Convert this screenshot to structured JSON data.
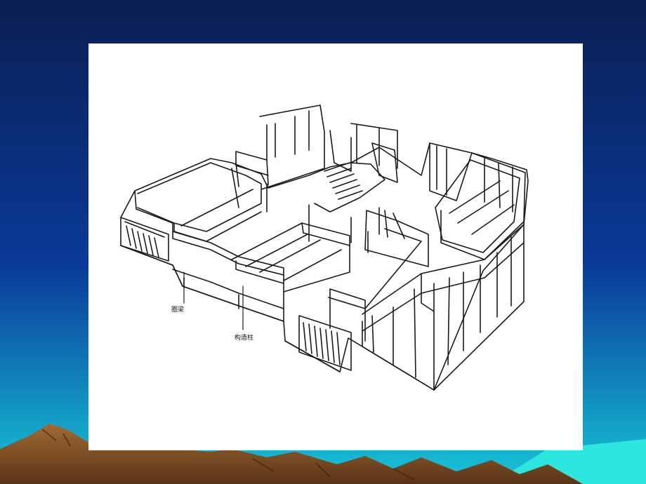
{
  "slide": {
    "background": {
      "top_color": "#0b1f52",
      "mid_color": "#0a3a9a",
      "bottom_color": "#17c6d8",
      "mountain_color": "#7a4a22",
      "horizon_color": "#2ee6e0"
    },
    "figure": {
      "labels": {
        "ring_beam": "圈梁",
        "structural_column": "构造柱"
      }
    }
  }
}
